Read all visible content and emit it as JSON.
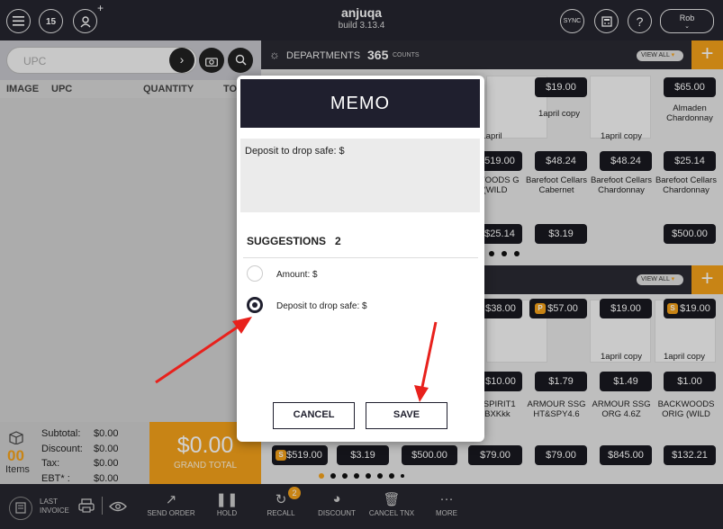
{
  "header": {
    "app_name": "anjuqa",
    "build": "build 3.13.4",
    "calendar_day": "15",
    "sync_label": "SYNC",
    "help_label": "?",
    "user_name": "Rob",
    "add_user_plus": "+"
  },
  "search": {
    "placeholder": "UPC"
  },
  "table": {
    "columns": [
      "IMAGE",
      "UPC",
      "QUANTITY",
      "TO"
    ]
  },
  "totals": {
    "items_count": "00",
    "items_label": "Items",
    "subtotal_label": "Subtotal:",
    "subtotal": "$0.00",
    "discount_label": "Discount:",
    "discount": "$0.00",
    "tax_label": "Tax:",
    "tax": "$0.00",
    "ebt_label": "EBT* :",
    "ebt": "$0.00",
    "grand_total": "$0.00",
    "grand_total_label": "GRAND TOTAL"
  },
  "departments": {
    "title": "DEPARTMENTS",
    "count": "365",
    "count_label": "COUNTS",
    "view_all": "VIEW ALL",
    "add": "+"
  },
  "products_top": [
    {
      "price": "$19.00",
      "name": "1april copy"
    },
    {
      "price": "$65.00",
      "name": "Almaden Chardonnay"
    },
    {
      "name": "1april copy"
    },
    {
      "name": "1april"
    }
  ],
  "products_row2": [
    {
      "price": "519.00",
      "name": "KWOODS G (WILD"
    },
    {
      "price": "$48.24",
      "name": "Barefoot Cellars Cabernet"
    },
    {
      "price": "$48.24",
      "name": "Barefoot Cellars Chardonnay"
    },
    {
      "price": "$25.14",
      "name": "Barefoot Cellars Chardonnay"
    }
  ],
  "products_row3": [
    {
      "price": "$25.14"
    },
    {
      "price": "$3.19"
    },
    {
      "price": "$500.00"
    }
  ],
  "section2": {
    "view_all": "VIEW ALL",
    "add": "+"
  },
  "products_s2_r1": [
    {
      "price": "$38.00"
    },
    {
      "price": "$57.00",
      "badge": "P"
    },
    {
      "price": "$19.00",
      "name": "1april copy"
    },
    {
      "price": "$19.00",
      "badge": "S",
      "name": "1april copy"
    }
  ],
  "products_s2_r2": [
    {
      "price": "$10.00",
      "name": "R SPIRIT1 JBXKkk"
    },
    {
      "price": "$1.79",
      "name": "ARMOUR SSG HT&SPY4.6"
    },
    {
      "price": "$1.49",
      "name": "ARMOUR SSG ORG 4.6Z"
    },
    {
      "price": "$1.00",
      "name": "BACKWOODS ORIG (WILD"
    }
  ],
  "products_s2_r3": [
    {
      "price": "$519.00",
      "badge": "S"
    },
    {
      "price": "$3.19"
    },
    {
      "price": "$500.00"
    },
    {
      "price": "$79.00"
    },
    {
      "price": "$79.00"
    },
    {
      "price": "$845.00"
    },
    {
      "price": "$132.21"
    }
  ],
  "footer": {
    "last_invoice": "LAST INVOICE",
    "items": [
      "SEND ORDER",
      "HOLD",
      "RECALL",
      "DISCOUNT",
      "CANCEL TNX",
      "MORE"
    ],
    "recall_badge": "2"
  },
  "memo": {
    "title": "MEMO",
    "text": "Deposit to drop safe: $",
    "suggestions_label": "SUGGESTIONS",
    "suggestions_count": "2",
    "options": [
      {
        "label": "Amount: $",
        "selected": false
      },
      {
        "label": "Deposit to drop safe: $",
        "selected": true
      }
    ],
    "cancel_label": "CANCEL",
    "save_label": "SAVE"
  },
  "colors": {
    "accent": "#f5a21a",
    "dark": "#1f1f2e",
    "annotation_arrow": "#e8211c"
  }
}
